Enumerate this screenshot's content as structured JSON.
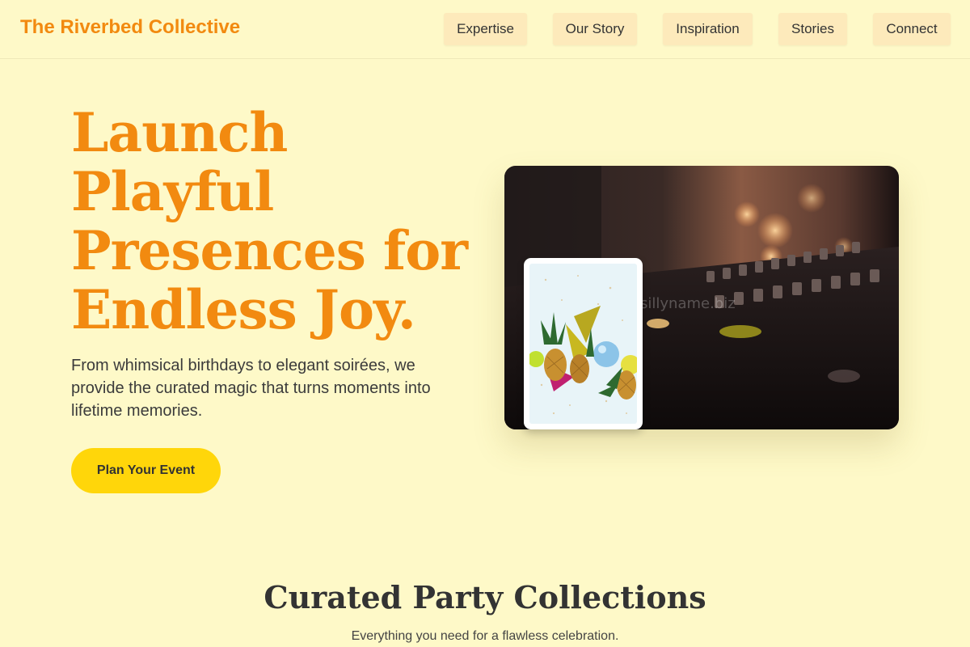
{
  "header": {
    "brand": "The Riverbed Collective",
    "nav": [
      {
        "label": "Expertise"
      },
      {
        "label": "Our Story"
      },
      {
        "label": "Inspiration"
      },
      {
        "label": "Stories"
      },
      {
        "label": "Connect"
      }
    ]
  },
  "hero": {
    "title": "Launch Playful Presences for Endless Joy.",
    "text": "From whimsical birthdays to elegant soirées, we provide the curated magic that turns moments into lifetime memories.",
    "cta": "Plan Your Event",
    "main_image_icon": "dj-mixer-photo",
    "inset_image_icon": "pineapples-party-hats-photo"
  },
  "section": {
    "title": "Curated Party Collections",
    "subtitle": "Everything you need for a flawless celebration."
  },
  "colors": {
    "background": "#fef9c8",
    "accent": "#f28a10",
    "nav_bg": "#fdeabb",
    "cta_bg": "#ffd60a"
  }
}
